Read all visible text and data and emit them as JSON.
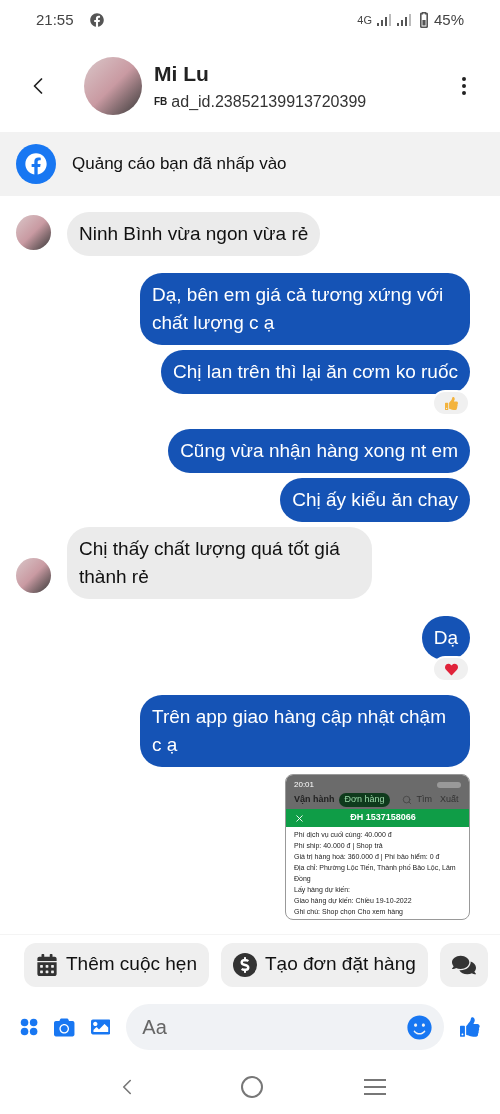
{
  "status_bar": {
    "time": "21:55",
    "network": "4G",
    "battery": "45%"
  },
  "header": {
    "name": "Mi Lu",
    "source_badge": "FB",
    "subtitle": "ad_id.23852139913720399"
  },
  "ad_banner": {
    "text": "Quảng cáo bạn đã nhấp vào"
  },
  "messages": [
    {
      "kind": "incoming",
      "text": "Ninh Bình vừa ngon vừa rẻ",
      "avatar": true
    },
    {
      "kind": "outgoing",
      "text": "Dạ, bên em giá cả tương xứng với chất lượng c ạ"
    },
    {
      "kind": "outgoing",
      "text": "Chị lan trên thì lại ăn cơm ko ruốc",
      "reaction": {
        "kind": "like"
      }
    },
    {
      "kind": "outgoing",
      "text": "Cũng vừa nhận hàng xong nt em"
    },
    {
      "kind": "outgoing",
      "text": "Chị ấy kiểu ăn chay"
    },
    {
      "kind": "incoming",
      "text": "Chị thấy chất lượng quá tốt giá thành rẻ",
      "avatar": true
    },
    {
      "kind": "outgoing",
      "text": "Dạ",
      "reaction": {
        "kind": "heart"
      }
    },
    {
      "kind": "outgoing",
      "text": "Trên app giao hàng cập nhật chậm c ạ"
    },
    {
      "kind": "image",
      "status_time": "20:01",
      "tabs": [
        {
          "label": "Vận hành",
          "selected": false
        },
        {
          "label": "Đơn hàng",
          "selected": true
        }
      ],
      "search_label": "Tìm",
      "export_label": "Xuất",
      "order_title": "ĐH 1537158066",
      "lines": [
        "Phí dịch vụ cuối cùng: 40.000 đ",
        "Phí ship: 40.000 đ | Shop trả",
        "Giá trị hàng hoá: 360.000 đ | Phí bảo hiểm: 0 đ",
        "Địa chỉ: Phường Lộc Tiến, Thành phố Bảo Lộc, Lâm Đồng",
        "Lấy hàng dự kiến:",
        "Giao hàng dự kiến: Chiều 19-10-2022",
        "Ghi chú: Shop chọn Cho xem hàng"
      ]
    }
  ],
  "quick_replies": [
    {
      "kind": "calendar",
      "label": "Thêm cuộc hẹn"
    },
    {
      "kind": "dollar",
      "label": "Tạo đơn đặt hàng"
    },
    {
      "kind": "chat"
    }
  ],
  "composer": {
    "placeholder": "Aa"
  }
}
